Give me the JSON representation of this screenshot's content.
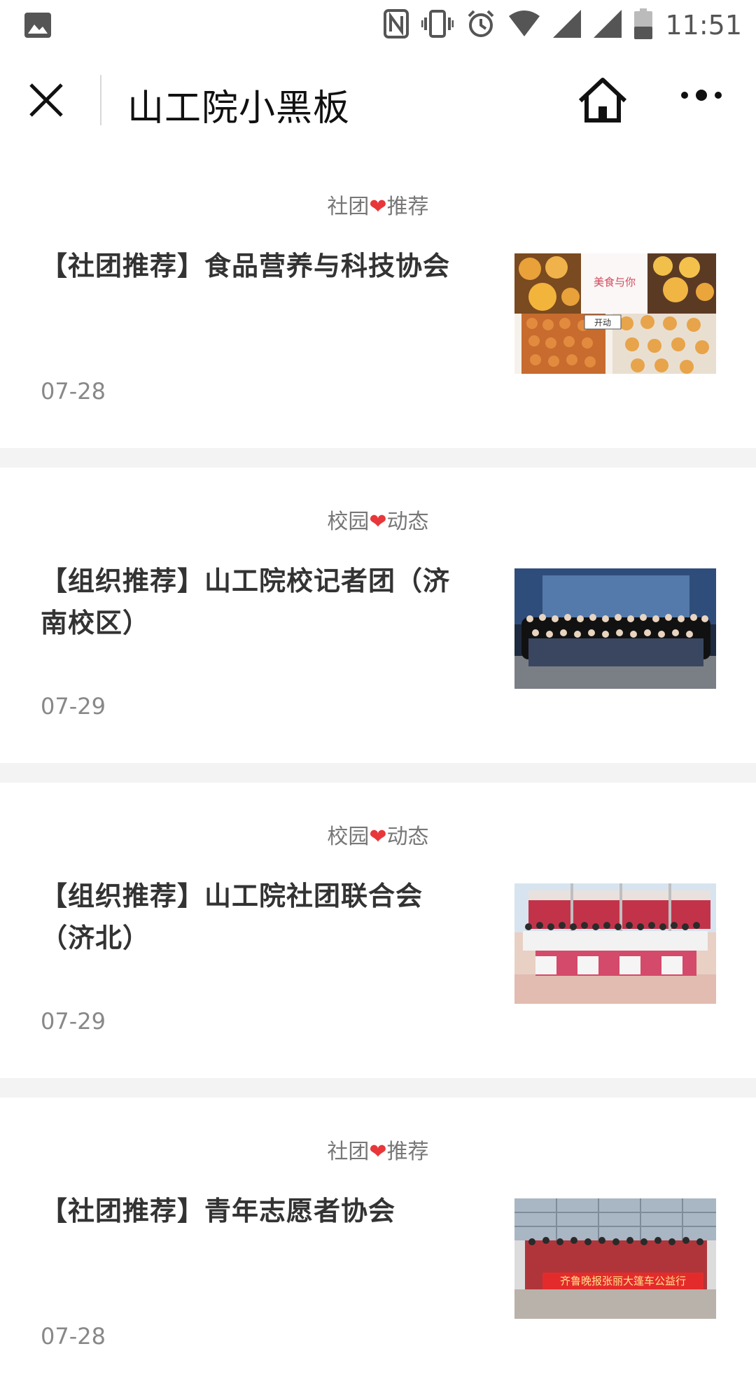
{
  "status_bar": {
    "time": "11:51"
  },
  "nav": {
    "title": "山工院小黑板"
  },
  "articles": [
    {
      "tag_left": "社团",
      "tag_right": "推荐",
      "title": "【社团推荐】食品营养与科技协会",
      "date": "07-28",
      "thumb_text_1": "美食与你",
      "thumb_text_2": "开动"
    },
    {
      "tag_left": "校园",
      "tag_right": "动态",
      "title": "【组织推荐】山工院校记者团（济南校区）",
      "date": "07-29"
    },
    {
      "tag_left": "校园",
      "tag_right": "动态",
      "title": "【组织推荐】山工院社团联合会（济北）",
      "date": "07-29"
    },
    {
      "tag_left": "社团",
      "tag_right": "推荐",
      "title": "【社团推荐】青年志愿者协会",
      "date": "07-28",
      "thumb_banner": "齐鲁晚报张丽大篷车公益行"
    }
  ],
  "colors": {
    "heart": "#e8373a",
    "separator": "#f3f3f3"
  }
}
